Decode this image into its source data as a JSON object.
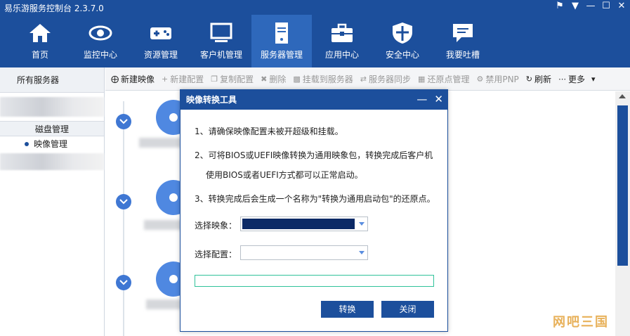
{
  "app": {
    "title": "易乐游服务控制台 2.3.7.0"
  },
  "nav": {
    "items": [
      {
        "label": "首页",
        "icon": "home-icon"
      },
      {
        "label": "监控中心",
        "icon": "eye-icon"
      },
      {
        "label": "资源管理",
        "icon": "gamepad-icon"
      },
      {
        "label": "客户机管理",
        "icon": "monitor-icon"
      },
      {
        "label": "服务器管理",
        "icon": "server-icon"
      },
      {
        "label": "应用中心",
        "icon": "toolbox-icon"
      },
      {
        "label": "安全中心",
        "icon": "shield-icon"
      },
      {
        "label": "我要吐槽",
        "icon": "chat-icon"
      }
    ],
    "active": "服务器管理"
  },
  "sidebar": {
    "header": "所有服务器",
    "group": "磁盘管理",
    "item": "映像管理"
  },
  "toolbar": {
    "new_image": "新建映像",
    "new_config": "新建配置",
    "copy_config": "复制配置",
    "delete": "删除",
    "mount": "挂载到服务器",
    "sync": "服务器同步",
    "restore": "还原点管理",
    "disable_pnp": "禁用PNP",
    "refresh": "刷新",
    "more": "更多"
  },
  "dialog": {
    "title": "映像转换工具",
    "line1": "1、请确保映像配置未被开超级和挂载。",
    "line2a": "2、可将BIOS或UEFI映像转换为通用映象包，转换完成后客户机",
    "line2b": "使用BIOS或者UEFI方式都可以正常启动。",
    "line3": "3、转换完成后会生成一个名称为\"转换为通用启动包\"的还原点。",
    "select_image_label": "选择映象：",
    "select_config_label": "选择配置：",
    "convert_button": "转换",
    "close_button": "关闭",
    "progress": 0
  },
  "watermark": "网吧三国",
  "colors": {
    "brand": "#1c4f9c",
    "nav_active": "#2e68bb",
    "accent": "#3f77d3",
    "progress_border": "#30c29a"
  }
}
